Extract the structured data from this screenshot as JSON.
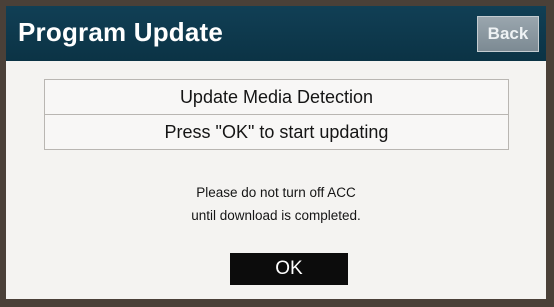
{
  "header": {
    "title": "Program Update",
    "back_label": "Back"
  },
  "info": {
    "line1": "Update Media Detection",
    "line2": "Press \"OK\" to start updating"
  },
  "warning": {
    "line1": "Please do not turn off ACC",
    "line2": "until download is completed."
  },
  "actions": {
    "ok_label": "OK"
  },
  "colors": {
    "header_bg": "#0b3345",
    "back_button_bg": "#8a979f",
    "screen_bg": "#f4f3f1",
    "ok_button_bg": "#0c0c0c"
  }
}
